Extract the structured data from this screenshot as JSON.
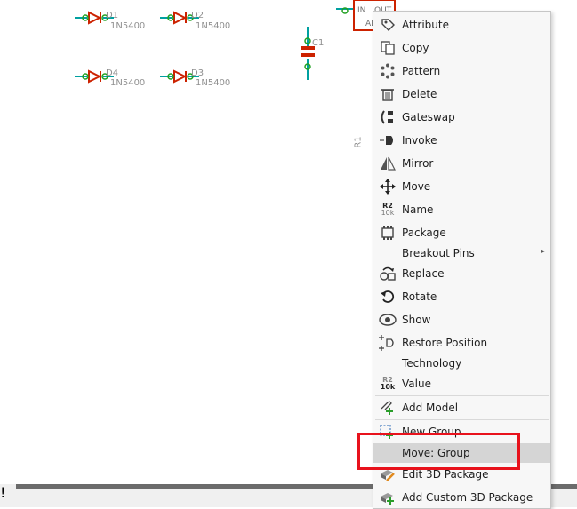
{
  "schematic": {
    "diodes": [
      {
        "name": "D1",
        "value": "1N5400"
      },
      {
        "name": "D2",
        "value": "1N5400"
      },
      {
        "name": "D4",
        "value": "1N5400"
      },
      {
        "name": "D3",
        "value": "1N5400"
      }
    ],
    "capacitor": {
      "name": "C1"
    },
    "resistor": {
      "name": "R1"
    },
    "regulator": {
      "in": "IN",
      "out": "OUT",
      "ref": "AD"
    },
    "colors": {
      "part": "#cc2200",
      "wire": "#00a0a0",
      "pin": "#20a020",
      "highlight": "#e8121c"
    }
  },
  "menu": {
    "items": [
      {
        "label": "Attribute",
        "icon": "tag-icon"
      },
      {
        "label": "Copy",
        "icon": "copy-icon"
      },
      {
        "label": "Pattern",
        "icon": "pattern-icon"
      },
      {
        "label": "Delete",
        "icon": "trash-icon"
      },
      {
        "label": "Gateswap",
        "icon": "gateswap-icon"
      },
      {
        "label": "Invoke",
        "icon": "invoke-icon"
      },
      {
        "label": "Mirror",
        "icon": "mirror-icon"
      },
      {
        "label": "Move",
        "icon": "move-icon"
      },
      {
        "label": "Name",
        "icon": "name-icon",
        "icon_text": "R2",
        "icon_subtext": "10k"
      },
      {
        "label": "Package",
        "icon": "package-icon"
      },
      {
        "label": "Breakout Pins",
        "icon": "",
        "submenu": true
      },
      {
        "label": "Replace",
        "icon": "replace-icon"
      },
      {
        "label": "Rotate",
        "icon": "rotate-icon"
      },
      {
        "label": "Show",
        "icon": "eye-icon"
      },
      {
        "label": "Restore Position",
        "icon": "restore-position-icon"
      },
      {
        "label": "Technology",
        "icon": ""
      },
      {
        "label": "Value",
        "icon": "value-icon",
        "icon_text": "R2",
        "icon_subtext": "10k"
      },
      {
        "label": "Add Model",
        "icon": "add-model-icon"
      },
      {
        "label": "New Group",
        "icon": "new-group-icon"
      },
      {
        "label": "Move: Group",
        "icon": "",
        "highlighted": true
      },
      {
        "label": "Edit 3D Package",
        "icon": "edit-3d-package-icon"
      },
      {
        "label": "Add Custom 3D Package",
        "icon": "add-custom-3d-package-icon"
      }
    ],
    "submenu_arrow": "▸"
  },
  "status_bar": {
    "info_glyph": "!"
  }
}
